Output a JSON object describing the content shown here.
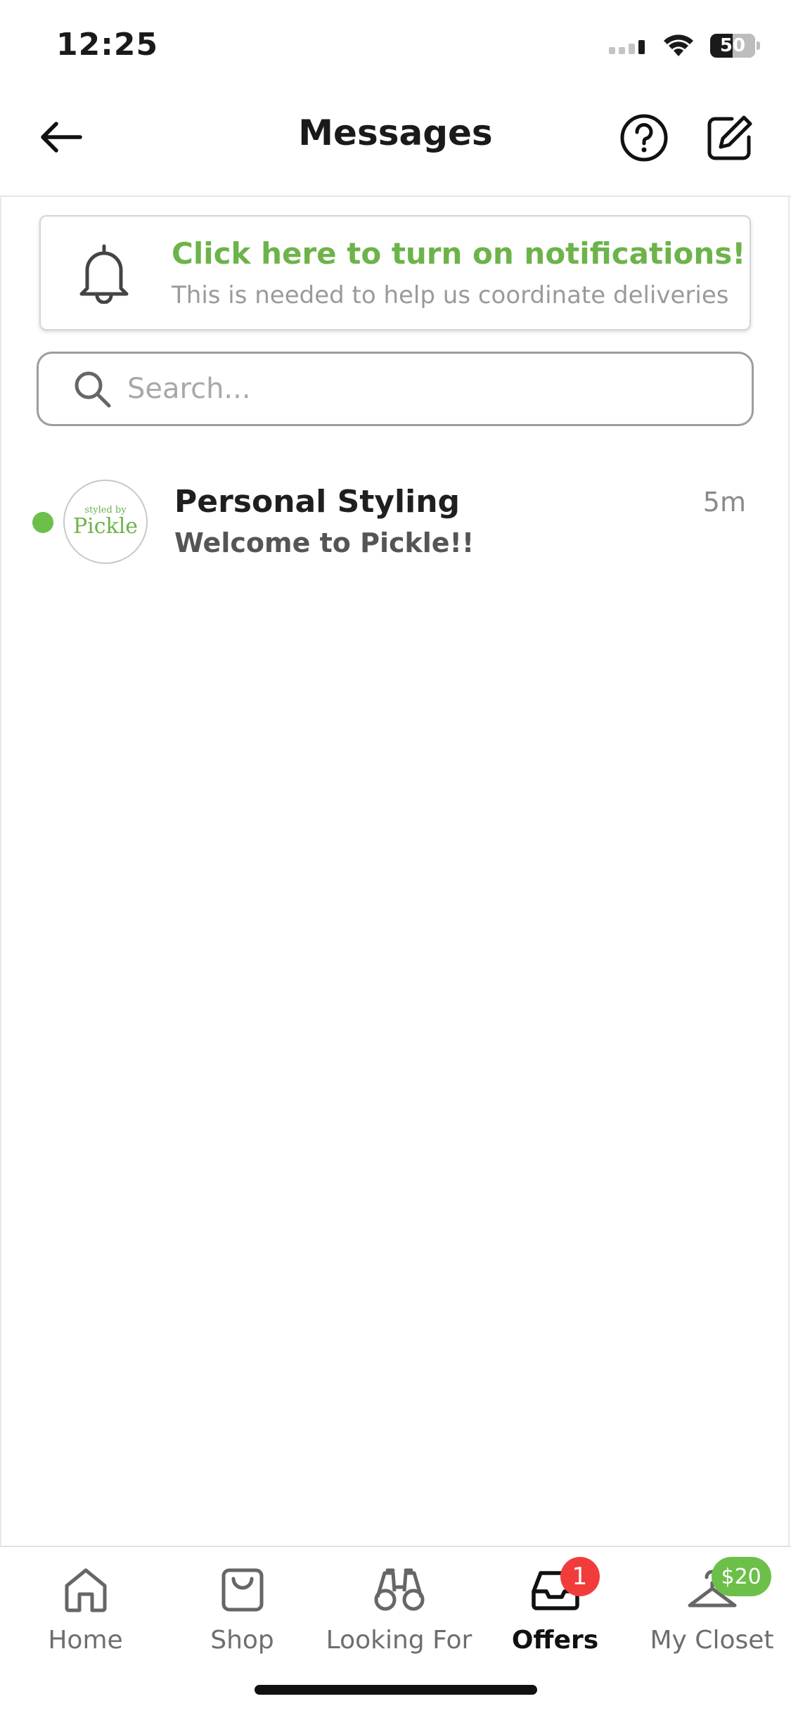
{
  "status_bar": {
    "time": "12:25",
    "battery": "50",
    "battery_level": 0.5
  },
  "header": {
    "title": "Messages",
    "back_icon": "arrow-left-icon",
    "help_icon": "question-circle-icon",
    "compose_icon": "compose-icon"
  },
  "notification_banner": {
    "title": "Click here to turn on notifications!",
    "subtitle": "This is needed to help us coordinate deliveries",
    "icon": "bell-icon",
    "title_color": "#6db34a"
  },
  "search": {
    "placeholder": "Search..."
  },
  "conversations": [
    {
      "name": "Personal Styling",
      "preview": "Welcome to Pickle!!",
      "time": "5m",
      "unread": true,
      "avatar_text_small": "styled by",
      "avatar_text_big": "Pickle"
    }
  ],
  "tabbar": {
    "tabs": [
      {
        "label": "Home",
        "icon": "home-icon",
        "active": false
      },
      {
        "label": "Shop",
        "icon": "shopping-bag-icon",
        "active": false
      },
      {
        "label": "Looking For",
        "icon": "binoculars-icon",
        "active": false
      },
      {
        "label": "Offers",
        "icon": "inbox-tray-icon",
        "active": true,
        "badge": "1"
      },
      {
        "label": "My Closet",
        "icon": "hanger-icon",
        "active": false,
        "badge": "$20"
      }
    ]
  },
  "colors": {
    "accent_green": "#6cc04a",
    "badge_red": "#f23c3c"
  }
}
